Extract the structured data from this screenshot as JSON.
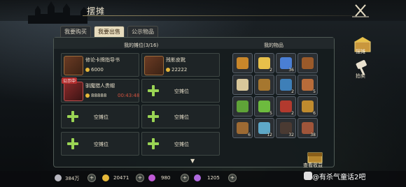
{
  "title": "摆摊",
  "tabs": [
    {
      "label": "我要购买",
      "active": false
    },
    {
      "label": "我要出售",
      "active": true
    },
    {
      "label": "公示物品",
      "active": false
    }
  ],
  "stall": {
    "title": "我的摊位(3/16)",
    "slots": [
      {
        "name": "修论卡牌指导书",
        "price": "6000",
        "timer": "",
        "on_sale": "",
        "empty": false
      },
      {
        "name": "残影皮靴",
        "price": "22222",
        "timer": "",
        "on_sale": "",
        "empty": false
      },
      {
        "name": "驯魔猎人贵帽",
        "price": "88888",
        "timer": "00:43:48",
        "on_sale": "公示中",
        "empty": false
      },
      {
        "name": "空摊位",
        "empty": true
      },
      {
        "name": "空摊位",
        "empty": true
      },
      {
        "name": "空摊位",
        "empty": true
      },
      {
        "name": "空摊位",
        "empty": true
      },
      {
        "name": "空摊位",
        "empty": true
      }
    ]
  },
  "inventory": {
    "title": "我的物品",
    "items": [
      {
        "count": "",
        "color": "#c9872a"
      },
      {
        "count": "2",
        "color": "#e7c04a"
      },
      {
        "count": "36",
        "color": "#4a7fd4"
      },
      {
        "count": "",
        "color": "#9a5a2a"
      },
      {
        "count": "",
        "color": "#d8c79a"
      },
      {
        "count": "",
        "color": "#a6772f"
      },
      {
        "count": "2",
        "color": "#3e7fb8"
      },
      {
        "count": "5",
        "color": "#b86c3a"
      },
      {
        "count": "",
        "color": "#5fa338"
      },
      {
        "count": "5",
        "color": "#6dbb3e"
      },
      {
        "count": "2",
        "color": "#b23a2e"
      },
      {
        "count": "6",
        "color": "#c08b2e"
      },
      {
        "count": "6",
        "color": "#9d6a33"
      },
      {
        "count": "12",
        "color": "#5ea8c8"
      },
      {
        "count": "32",
        "color": "#4a3a32"
      },
      {
        "count": "38",
        "color": "#a0553a"
      }
    ]
  },
  "side": {
    "stall_label": "摆摊",
    "auction_label": "拍卖"
  },
  "view_earnings": "查看收益",
  "currency": [
    {
      "value": "384万",
      "color": "#b7b7c0"
    },
    {
      "value": "20471",
      "color": "#e6b83a"
    },
    {
      "value": "980",
      "color": "#c05ad6"
    },
    {
      "value": "1205",
      "color": "#b06ae0"
    }
  ],
  "watermark": "@有杀气童话2吧"
}
